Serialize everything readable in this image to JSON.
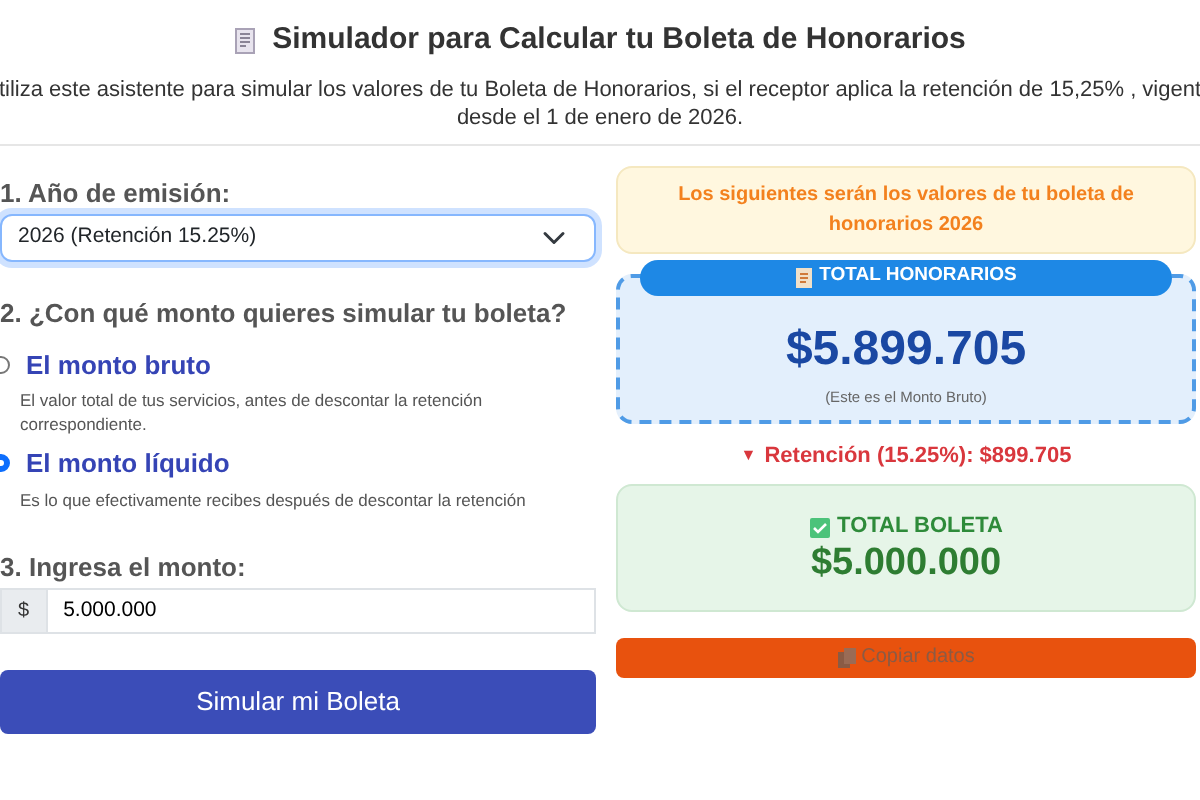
{
  "title": "Simulador para Calcular tu Boleta de Honorarios",
  "intro": [
    "tiliza este asistente para simular los valores de tu Boleta de Honorarios, si el receptor aplica la retención de 15,25% , vigent",
    "desde el 1 de enero de 2026."
  ],
  "year": {
    "label": "1. Año de emisión:",
    "value": "2026 (Retención 15.25%)"
  },
  "mode": {
    "label": "2. ¿Con qué monto quieres simular tu boleta?",
    "options": [
      {
        "title": "El monto bruto",
        "description": "El valor total de tus servicios, antes de descontar la retención correspondiente.",
        "selected": false
      },
      {
        "title": "El monto líquido",
        "description": "Es lo que efectivamente recibes después de descontar la retención",
        "selected": true
      }
    ]
  },
  "amount": {
    "label": "3. Ingresa el monto:",
    "prefix": "$",
    "value": "5.000.000"
  },
  "submit": "Simular mi Boleta",
  "result": {
    "notice": "Los siguientes serán los valores de tu boleta de honorarios 2026",
    "honorarios": {
      "title": "TOTAL HONORARIOS",
      "value": "$5.899.705",
      "note": "(Este es el Monto Bruto)"
    },
    "retention": {
      "marker": "▼",
      "text": "Retención (15.25%): $899.705"
    },
    "boleta": {
      "title": "TOTAL BOLETA",
      "value": "$5.000.000"
    },
    "copy": "Copiar datos"
  }
}
